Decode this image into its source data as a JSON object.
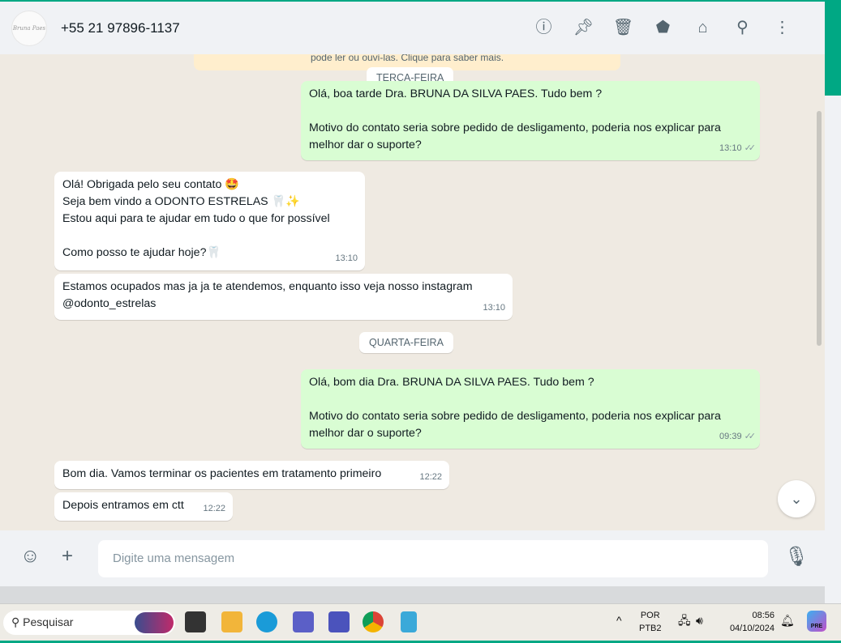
{
  "header": {
    "avatar_text": "Bruna Paes",
    "contact": "+55 21 97896-1137",
    "icons": [
      "info-icon",
      "pin-icon",
      "delete-icon",
      "label-icon",
      "store-icon",
      "search-icon",
      "menu-icon"
    ]
  },
  "notice": "pode ler ou ouvi-las. Clique para saber mais.",
  "days": [
    "TERÇA-FEIRA",
    "QUARTA-FEIRA"
  ],
  "messages": [
    {
      "text": "Olá, boa tarde Dra. BRUNA DA SILVA PAES. Tudo bem ?\n\nMotivo do contato seria sobre pedido de desligamento, poderia nos explicar para melhor dar o suporte?",
      "time": "13:10"
    },
    {
      "text": "Olá! Obrigada pelo seu contato 🤩\nSeja bem vindo a ODONTO ESTRELAS 🦷✨\nEstou aqui para te ajudar em tudo o que for possível\n\nComo posso te ajudar hoje?🦷",
      "time": "13:10"
    },
    {
      "text": "Estamos ocupados mas ja ja te atendemos, enquanto isso veja nosso instagram @odonto_estrelas",
      "time": "13:10"
    },
    {
      "text": "Olá, bom dia  Dra. BRUNA DA SILVA PAES. Tudo bem ?\n\nMotivo do contato seria sobre pedido de desligamento, poderia nos explicar para melhor dar o suporte?",
      "time": "09:39"
    },
    {
      "text": "Bom dia. Vamos terminar os pacientes em tratamento primeiro",
      "time": "12:22"
    },
    {
      "text": "Depois entramos em ctt",
      "time": "12:22"
    }
  ],
  "composer": {
    "placeholder": "Digite uma mensagem"
  },
  "taskbar": {
    "search": "Pesquisar",
    "lang1": "POR",
    "lang2": "PTB2",
    "time": "08:56",
    "date": "04/10/2024",
    "badge": "PRE"
  }
}
